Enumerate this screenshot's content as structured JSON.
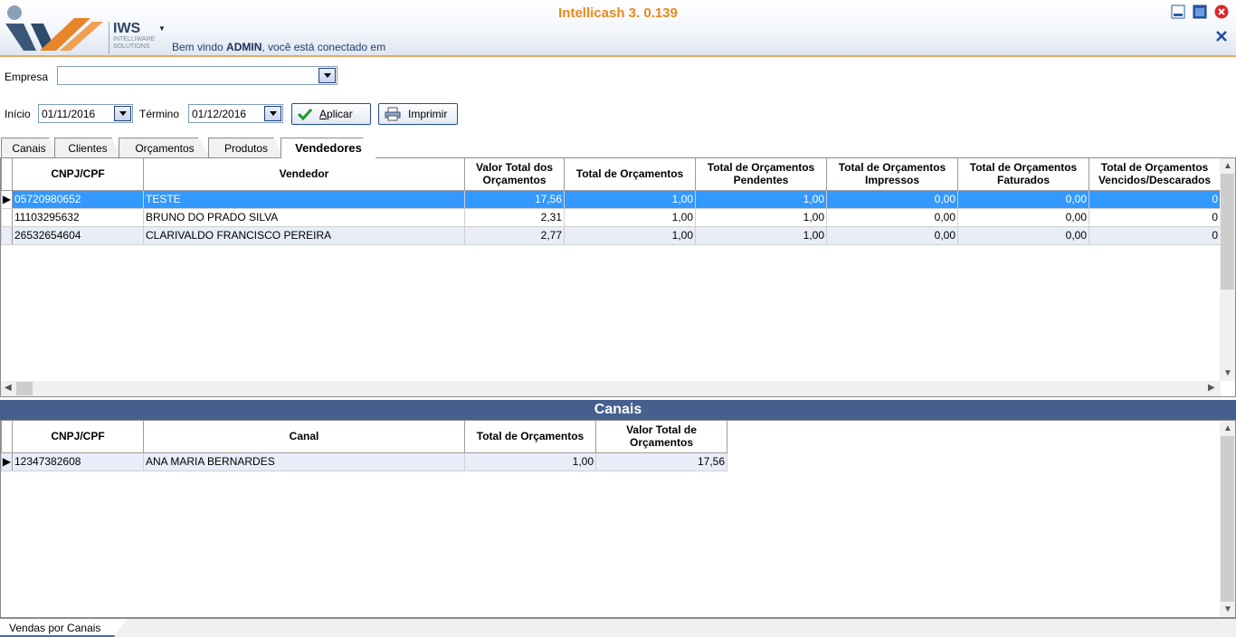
{
  "header": {
    "app_title": "Intellicash 3. 0.139",
    "logo_text": "IWS",
    "logo_sub": "INTELLIWARE SOLUTIONS",
    "welcome_prefix": "Bem vindo ",
    "welcome_user": "ADMIN",
    "welcome_suffix": ", você está conectado em"
  },
  "filters": {
    "empresa_label": "Empresa",
    "empresa_value": "",
    "inicio_label": "Início",
    "inicio_value": "01/11/2016",
    "termino_label": "Término",
    "termino_value": "01/12/2016",
    "aplicar_label": "plicar",
    "aplicar_accel": "A",
    "imprimir_label": "Imprimir"
  },
  "tabs": [
    "Canais",
    "Clientes",
    "Orçamentos",
    "Produtos",
    "Vendedores"
  ],
  "active_tab": "Vendedores",
  "vendedores_grid": {
    "headers": [
      "CNPJ/CPF",
      "Vendedor",
      "Valor Total dos Orçamentos",
      "Total de Orçamentos",
      "Total de Orçamentos Pendentes",
      "Total de Orçamentos Impressos",
      "Total de Orçamentos Faturados",
      "Total de Orçamentos Vencidos/Descarados"
    ],
    "rows": [
      [
        "05720980652",
        "TESTE",
        "17,56",
        "1,00",
        "1,00",
        "0,00",
        "0,00",
        "0"
      ],
      [
        "11103295632",
        "BRUNO DO PRADO SILVA",
        "2,31",
        "1,00",
        "1,00",
        "0,00",
        "0,00",
        "0"
      ],
      [
        "26532654604",
        "CLARIVALDO FRANCISCO PEREIRA",
        "2,77",
        "1,00",
        "1,00",
        "0,00",
        "0,00",
        "0"
      ]
    ]
  },
  "canais_section": {
    "title": "Canais",
    "headers": [
      "CNPJ/CPF",
      "Canal",
      "Total de Orçamentos",
      "Valor Total de Orçamentos"
    ],
    "rows": [
      [
        "12347382608",
        "ANA MARIA BERNARDES",
        "1,00",
        "17,56"
      ]
    ]
  },
  "bottom_tab": "Vendas por Canais",
  "colors": {
    "title_orange": "#e68a1a",
    "selection_blue": "#3399ff",
    "section_bar": "#455f8e"
  }
}
